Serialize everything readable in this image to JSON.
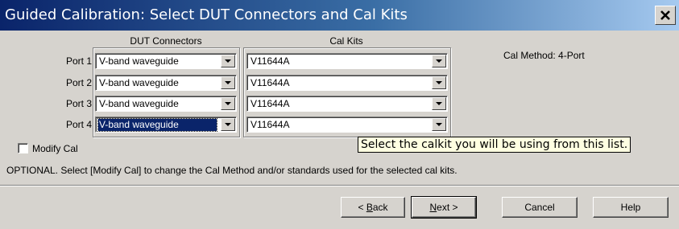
{
  "window": {
    "title": "Guided Calibration: Select DUT Connectors and Cal Kits"
  },
  "headers": {
    "dut_connectors": "DUT Connectors",
    "cal_kits": "Cal Kits"
  },
  "cal_method": "Cal Method:  4-Port",
  "ports": [
    {
      "label": "Port 1",
      "connector": "V-band waveguide",
      "calkit": "V11644A",
      "selected": false
    },
    {
      "label": "Port 2",
      "connector": "V-band waveguide",
      "calkit": "V11644A",
      "selected": false
    },
    {
      "label": "Port 3",
      "connector": "V-band waveguide",
      "calkit": "V11644A",
      "selected": false
    },
    {
      "label": "Port 4",
      "connector": "V-band waveguide",
      "calkit": "V11644A",
      "selected": true
    }
  ],
  "modify_cal": {
    "label": "Modify Cal",
    "checked": false
  },
  "tooltip": "Select the calkit you will be using from this list.",
  "optional_text": "OPTIONAL.  Select [Modify Cal] to change the Cal Method and/or standards used for the selected cal kits.",
  "buttons": {
    "back": {
      "prefix": "< ",
      "mnemonic": "B",
      "rest": "ack"
    },
    "next": {
      "mnemonic": "N",
      "rest": "ext",
      "suffix": " >"
    },
    "cancel": "Cancel",
    "help": "Help"
  },
  "icons": {
    "close": "close-icon",
    "dropdown": "chevron-down-icon"
  }
}
